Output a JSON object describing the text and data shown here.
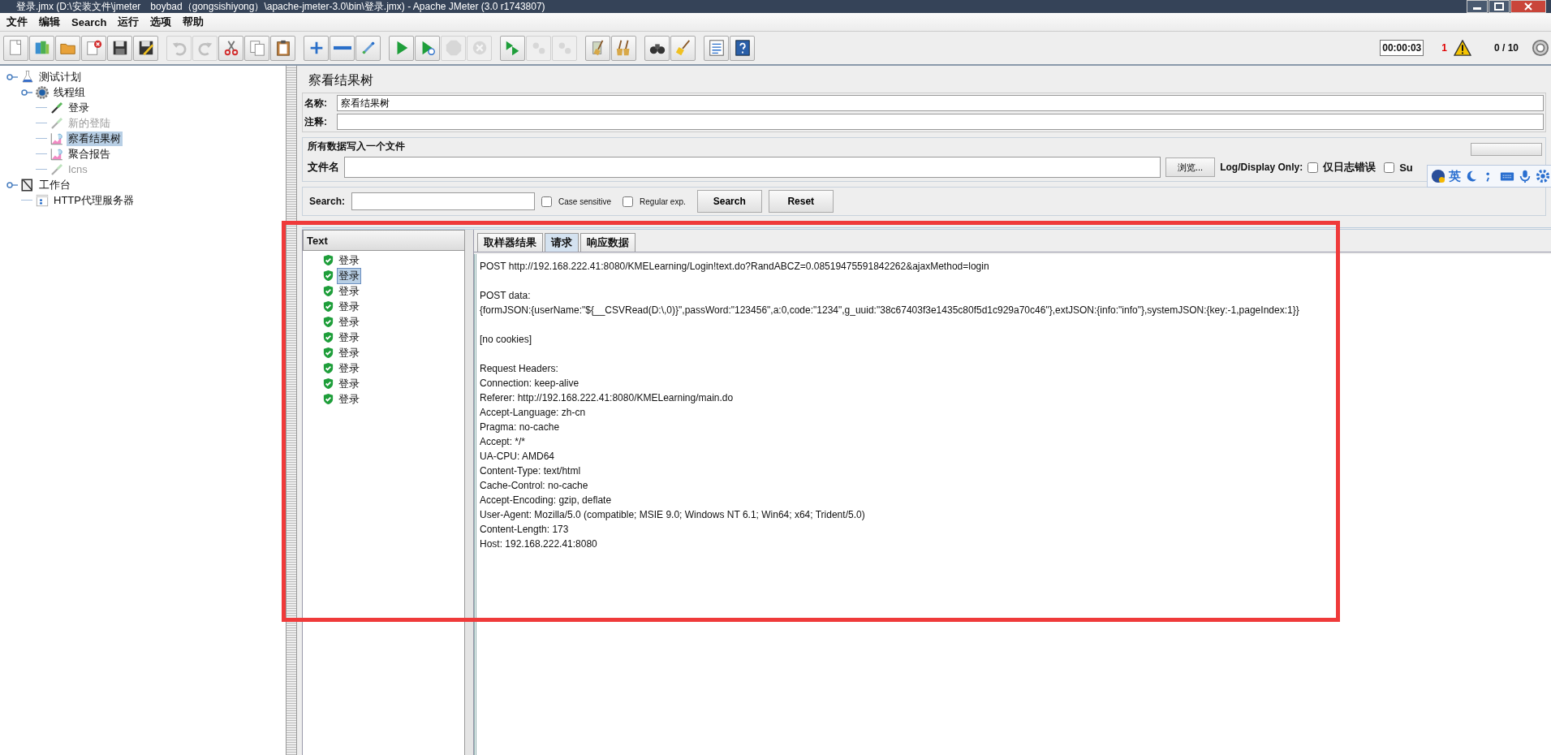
{
  "window": {
    "title": "登录.jmx (D:\\安装文件\\jmeter　boybad（gongsishiyong）\\apache-jmeter-3.0\\bin\\登录.jmx) - Apache JMeter (3.0 r1743807)"
  },
  "menu": [
    "文件",
    "编辑",
    "Search",
    "运行",
    "选项",
    "帮助"
  ],
  "toolbar": {
    "groups": [
      [
        {
          "kind": "new",
          "disabled": false
        },
        {
          "kind": "templates",
          "disabled": false
        },
        {
          "kind": "open",
          "disabled": false
        },
        {
          "kind": "close",
          "disabled": false
        },
        {
          "kind": "save",
          "disabled": false
        },
        {
          "kind": "save-as",
          "disabled": false
        }
      ],
      [
        {
          "kind": "undo",
          "disabled": true
        },
        {
          "kind": "redo",
          "disabled": true
        },
        {
          "kind": "cut",
          "disabled": false
        },
        {
          "kind": "copy",
          "disabled": false
        },
        {
          "kind": "paste",
          "disabled": false
        }
      ],
      [
        {
          "kind": "expand",
          "disabled": false
        },
        {
          "kind": "collapse",
          "disabled": false
        },
        {
          "kind": "toggle",
          "disabled": false
        }
      ],
      [
        {
          "kind": "start",
          "disabled": false
        },
        {
          "kind": "start-no-pause",
          "disabled": false
        },
        {
          "kind": "stop",
          "disabled": true
        },
        {
          "kind": "shutdown",
          "disabled": true
        }
      ],
      [
        {
          "kind": "remote-start",
          "disabled": false
        },
        {
          "kind": "remote-stop",
          "disabled": true
        },
        {
          "kind": "remote-exit",
          "disabled": true
        }
      ],
      [
        {
          "kind": "clear",
          "disabled": false
        },
        {
          "kind": "clear-all",
          "disabled": false
        }
      ],
      [
        {
          "kind": "search",
          "disabled": false
        },
        {
          "kind": "reset-search",
          "disabled": false
        }
      ],
      [
        {
          "kind": "function",
          "disabled": false
        },
        {
          "kind": "help",
          "disabled": false
        }
      ]
    ],
    "timer": "00:00:03",
    "warnings": "1",
    "threads": "0 / 10"
  },
  "tree": [
    {
      "label": "测试计划",
      "kind": "plan",
      "enabled": true,
      "selected": false,
      "children": [
        {
          "label": "线程组",
          "kind": "thread-group",
          "enabled": true,
          "selected": false,
          "children": [
            {
              "label": "登录",
              "kind": "sampler",
              "enabled": true,
              "selected": false
            },
            {
              "label": "新的登陆",
              "kind": "sampler",
              "enabled": false,
              "selected": false
            },
            {
              "label": "察看结果树",
              "kind": "listener",
              "enabled": true,
              "selected": true
            },
            {
              "label": "聚合报告",
              "kind": "listener",
              "enabled": true,
              "selected": false
            },
            {
              "label": "Icns",
              "kind": "sampler",
              "enabled": false,
              "selected": false
            }
          ]
        }
      ]
    },
    {
      "label": "工作台",
      "kind": "workbench",
      "enabled": true,
      "selected": false,
      "children": [
        {
          "label": "HTTP代理服务器",
          "kind": "proxy",
          "enabled": true,
          "selected": false
        }
      ]
    }
  ],
  "panel": {
    "title": "察看结果树",
    "name_label": "名称:",
    "name_value": "察看结果树",
    "comment_label": "注释:",
    "file_group": {
      "title": "所有数据写入一个文件",
      "file_label": "文件名",
      "browse": "浏览...",
      "log_label": "Log/Display Only:",
      "errors_label": "仅日志错误",
      "errors_checked": false,
      "success_label": "Su",
      "success_checked": false
    },
    "search": {
      "label": "Search:",
      "case_label": "Case sensitive",
      "case_checked": false,
      "regex_label": "Regular exp.",
      "regex_checked": false,
      "search_button": "Search",
      "reset_button": "Reset"
    },
    "renderer": "Text",
    "results": [
      {
        "label": "登录",
        "selected": false
      },
      {
        "label": "登录",
        "selected": true
      },
      {
        "label": "登录",
        "selected": false
      },
      {
        "label": "登录",
        "selected": false
      },
      {
        "label": "登录",
        "selected": false
      },
      {
        "label": "登录",
        "selected": false
      },
      {
        "label": "登录",
        "selected": false
      },
      {
        "label": "登录",
        "selected": false
      },
      {
        "label": "登录",
        "selected": false
      },
      {
        "label": "登录",
        "selected": false
      }
    ],
    "tabs": [
      {
        "label": "取样器结果",
        "selected": false
      },
      {
        "label": "请求",
        "selected": true
      },
      {
        "label": "响应数据",
        "selected": false
      }
    ],
    "request_blocks": [
      [
        "POST http://192.168.222.41:8080/KMELearning/Login!text.do?RandABCZ=0.08519475591842262&ajaxMethod=login"
      ],
      [
        "POST data:",
        "{formJSON:{userName:\"${__CSVRead(D:\\,0)}\",passWord:\"123456\",a:0,code:\"1234\",g_uuid:\"38c67403f3e1435c80f5d1c929a70c46\"},extJSON:{info:\"info\"},systemJSON:{key:-1,pageIndex:1}}"
      ],
      [
        "[no cookies]"
      ],
      [
        "Request Headers:",
        "Connection: keep-alive",
        "Referer: http://192.168.222.41:8080/KMELearning/main.do",
        "Accept-Language: zh-cn",
        "Pragma: no-cache",
        "Accept: */*",
        "UA-CPU: AMD64",
        "Content-Type: text/html",
        "Cache-Control: no-cache",
        "Accept-Encoding: gzip, deflate",
        "User-Agent: Mozilla/5.0 (compatible; MSIE 9.0; Windows NT 6.1; Win64; x64; Trident/5.0)",
        "Content-Length: 173",
        "Host: 192.168.222.41:8080"
      ]
    ]
  },
  "ime_bar": {
    "language": "英"
  }
}
